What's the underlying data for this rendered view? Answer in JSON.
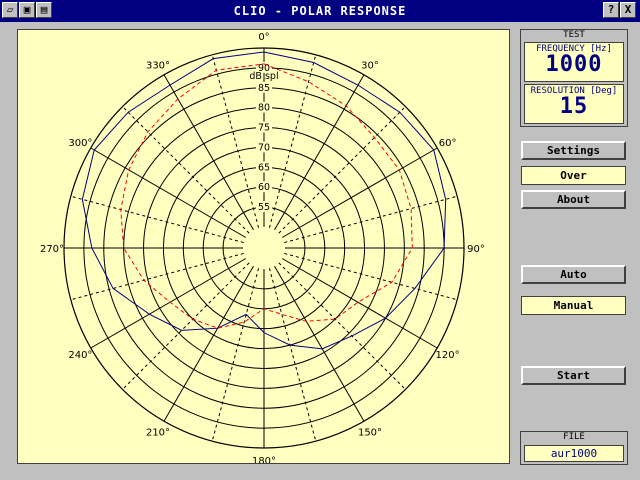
{
  "window": {
    "title": "CLIO - POLAR RESPONSE"
  },
  "titlebar_buttons": {
    "help": "?",
    "close": "X"
  },
  "test_panel": {
    "header": "TEST",
    "frequency_label": "FREQUENCY [Hz]",
    "frequency_value": "1000",
    "resolution_label": "RESOLUTION [Deg]",
    "resolution_value": "15"
  },
  "buttons": {
    "settings": "Settings",
    "over": "Over",
    "about": "About",
    "auto": "Auto",
    "manual": "Manual",
    "start": "Start"
  },
  "file_panel": {
    "header": "FILE",
    "value": "aur1000"
  },
  "chart_data": {
    "type": "polar",
    "unit_label": "dB spl",
    "radial_ticks": [
      55,
      60,
      65,
      70,
      75,
      80,
      85,
      90
    ],
    "rlim": [
      50,
      95
    ],
    "angle_labels": [
      "0°",
      "30°",
      "60°",
      "90°",
      "120°",
      "150°",
      "180°",
      "210°",
      "240°",
      "270°",
      "300°",
      "330°"
    ],
    "colors": {
      "blue": "#000080",
      "red": "#ff0000",
      "grid": "#000000"
    },
    "series": [
      {
        "style": "solid-blue",
        "angles": [
          0,
          15,
          30,
          45,
          60,
          75,
          90,
          105,
          120,
          135,
          150,
          165,
          180,
          195,
          210,
          225,
          240,
          255,
          270,
          285,
          300,
          315,
          330,
          345
        ],
        "values": [
          94,
          93,
          92,
          93,
          94,
          92,
          90,
          84,
          80,
          76,
          74,
          70,
          66,
          62,
          68,
          74,
          78,
          84,
          88,
          92,
          94,
          93,
          92,
          94
        ]
      },
      {
        "style": "dashed-red",
        "angles": [
          0,
          15,
          30,
          45,
          60,
          75,
          90,
          105,
          120,
          135,
          150,
          165,
          180,
          195,
          210,
          225,
          240,
          255,
          270,
          285,
          300,
          315,
          330,
          345
        ],
        "values": [
          91,
          88,
          86,
          84,
          84,
          83,
          82,
          78,
          72,
          70,
          66,
          62,
          60,
          64,
          68,
          70,
          72,
          76,
          80,
          82,
          84,
          86,
          88,
          91
        ]
      }
    ]
  }
}
